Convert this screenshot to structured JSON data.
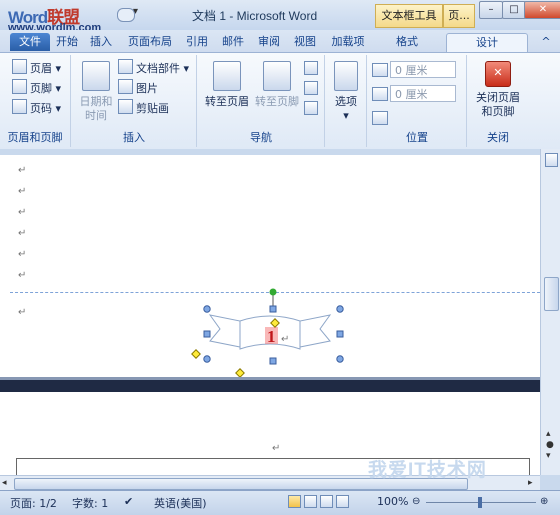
{
  "title_bar": {
    "logo_text": "Word",
    "logo_accent": "联盟",
    "logo_url": "www.wordlm.com",
    "window_title": "文档 1 - Microsoft Word",
    "context_tab_group": "文本框工具",
    "context_tab_group2": "页...",
    "minimize": "–",
    "restore": "□",
    "close": "✕"
  },
  "tabs": [
    "开始",
    "插入",
    "页面布局",
    "引用",
    "邮件",
    "审阅",
    "视图",
    "加载项",
    "格式",
    "设计"
  ],
  "active_tab": "设计",
  "file_tab": "文件",
  "ribbon": {
    "group_header_footer": {
      "label": "页眉和页脚",
      "items": [
        "页眉",
        "页脚",
        "页码"
      ]
    },
    "group_insert": {
      "label": "插入",
      "date_time": "日期和\n时间",
      "items": [
        "文档部件",
        "图片",
        "剪贴画"
      ]
    },
    "group_nav": {
      "label": "导航",
      "goto_header": "转至页眉",
      "goto_footer": "转至页脚"
    },
    "group_options": {
      "label": "选项",
      "options": "选项"
    },
    "group_position": {
      "label": "位置",
      "header_offset": "0 厘米",
      "footer_offset": "0 厘米"
    },
    "group_close": {
      "label": "关闭",
      "close_btn": "关闭页眉\n和页脚"
    }
  },
  "document": {
    "para_mark": "↵",
    "page_number": "1"
  },
  "status": {
    "page": "页面: 1/2",
    "words": "字数: 1",
    "language": "英语(美国)",
    "zoom": "100%"
  },
  "watermark": "我爱IT技术网"
}
